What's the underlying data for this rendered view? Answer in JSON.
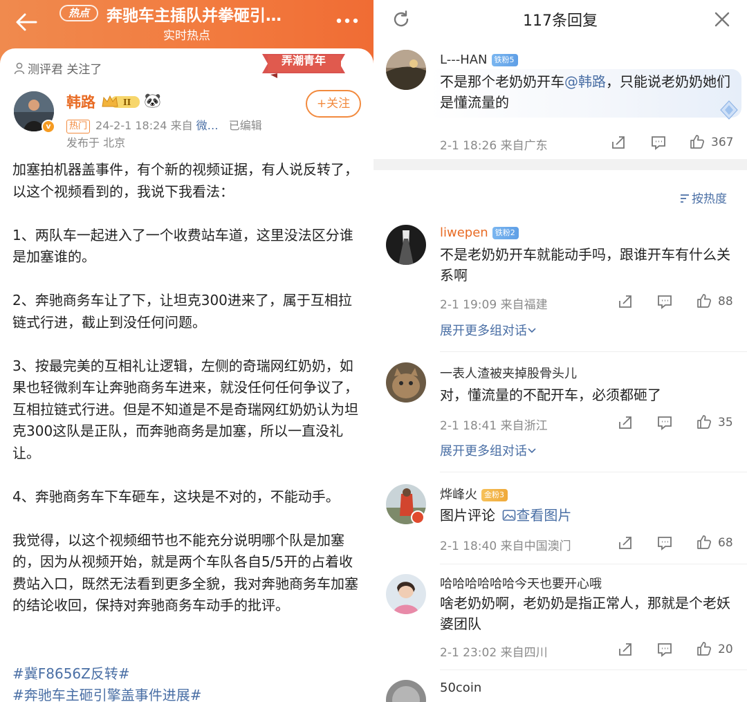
{
  "left": {
    "header": {
      "tag": "热点",
      "title": "奔驰车主插队并拳砸引…",
      "subtitle": "实时热点"
    },
    "post": {
      "follow_note": "测评君 关注了",
      "ribbon": "弄潮青年",
      "author": "韩路",
      "follow_button": "+关注",
      "hot_badge": "热门",
      "date_src": "24-2-1 18:24  来自",
      "source": "微…",
      "edited": "已编辑",
      "location": "发布于 北京",
      "paragraphs": [
        "加塞拍机器盖事件，有个新的视频证据，有人说反转了，以这个视频看到的，我说下我看法：",
        "1、两队车一起进入了一个收费站车道，这里没法区分谁是加塞谁的。",
        "2、奔驰商务车让了下，让坦克300进来了，属于互相拉链式行进，截止到没任何问题。",
        "3、按最完美的互相礼让逻辑，左侧的奇瑞网红奶奶，如果也轻微刹车让奔驰商务车进来，就没任何任何争议了，互相拉链式行进。但是不知道是不是奇瑞网红奶奶认为坦克300这队是正队，而奔驰商务是加塞，所以一直没礼让。",
        "4、奔驰商务车下车砸车，这块是不对的，不能动手。",
        "我觉得，以这个视频细节也不能充分说明哪个队是加塞的，因为从视频开始，就是两个车队各自5/5开的占着收费站入口，既然无法看到更多全貌，我对奔驰商务车加塞的结论收回，保持对奔驰商务车动手的批评。"
      ],
      "hashtags": [
        "#冀F8656Z反转#",
        "#奔驰车主砸引擎盖事件进展#"
      ]
    }
  },
  "right": {
    "title": "117条回复",
    "sort_label": "按热度",
    "expand_label": "展开更多组对话",
    "comments": [
      {
        "name": "L---HAN",
        "badge": "铁粉5",
        "text_before": "不是那个老奶奶开车",
        "mention": "@韩路",
        "text_after": "，只能说老奶奶她们是懂流量的",
        "meta": "2-1 18:26  来自广东",
        "likes": "367"
      },
      {
        "name": "liwepen",
        "badge": "铁粉2",
        "text": "不是老奶奶开车就能动手吗，跟谁开车有什么关系啊",
        "meta": "2-1 19:09  来自福建",
        "likes": "88"
      },
      {
        "name": "一表人渣被夹掉股骨头儿",
        "text": "对，懂流量的不配开车，必须都砸了",
        "meta": "2-1 18:41  来自浙江",
        "likes": "35"
      },
      {
        "name": "烨峰火",
        "badge": "金粉3",
        "text": "图片评论",
        "link": "查看图片",
        "meta": "2-1 18:40  来自中国澳门",
        "likes": "68"
      },
      {
        "name": "哈哈哈哈哈哈今天也要开心哦",
        "text": "啥老奶奶啊，老奶奶是指正常人，那就是个老妖婆团队",
        "meta": "2-1 23:02  来自四川",
        "likes": "20"
      },
      {
        "name": "50coin"
      }
    ]
  },
  "colors": {
    "brand_orange": "#f08a4e",
    "link_blue": "#4a6fa5",
    "name_orange": "#e86b24"
  }
}
